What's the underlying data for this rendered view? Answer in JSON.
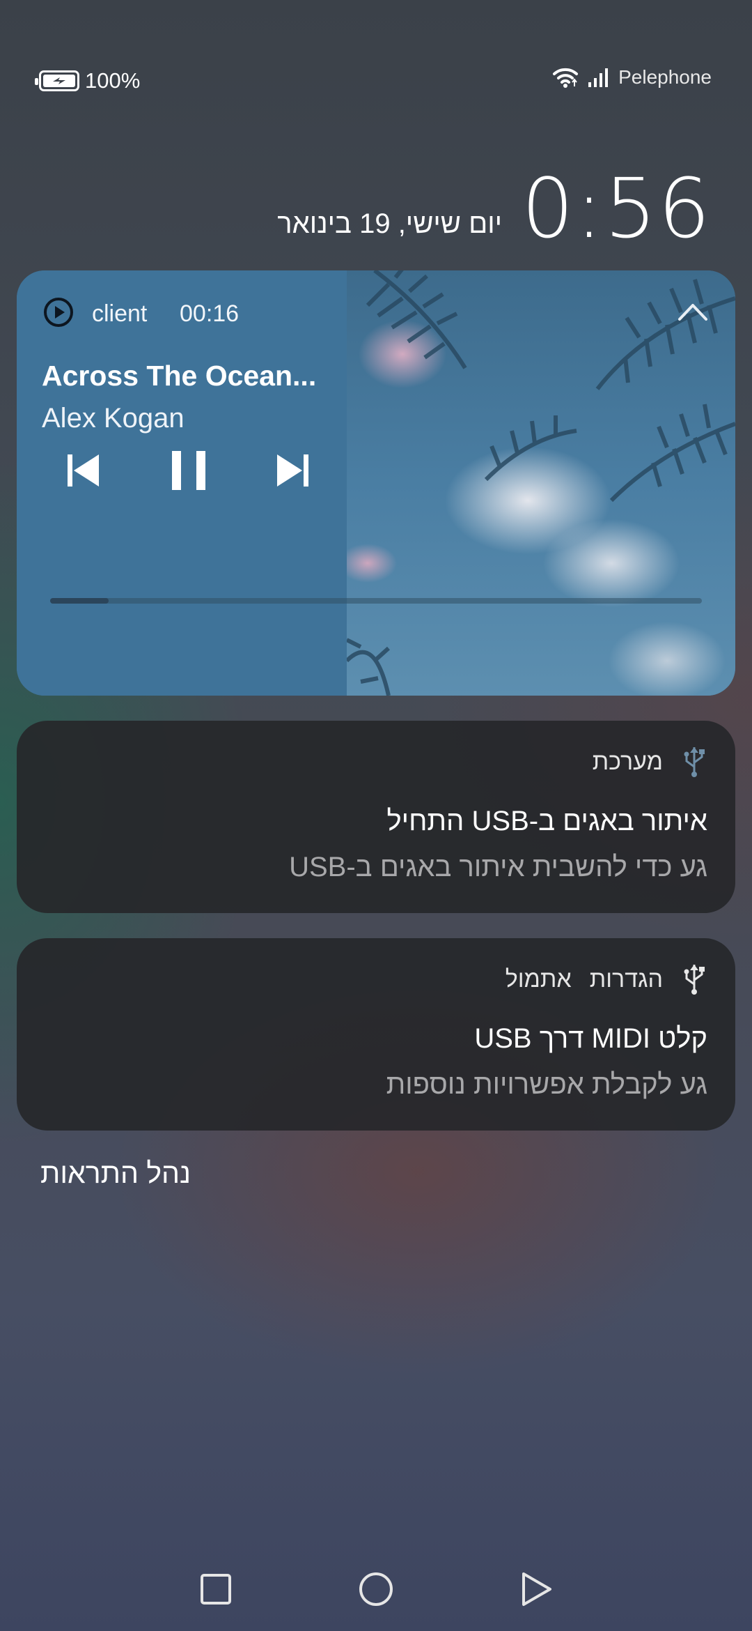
{
  "status_bar": {
    "battery_percent": "100%",
    "battery_level": 1.0,
    "carrier": "Pelephone",
    "icons": [
      "battery-charging-icon",
      "wifi-icon",
      "cell-signal-icon"
    ]
  },
  "lockscreen": {
    "time": "0:56",
    "date": "יום שישי, 19 בינואר"
  },
  "media": {
    "app_name": "client",
    "elapsed": "00:16",
    "title": "Across The Ocean...",
    "artist": "Alex Kogan",
    "progress": 0.09,
    "accent": "#3f7399",
    "icons": [
      "play-circle-icon",
      "chevron-up-icon",
      "skip-previous-icon",
      "pause-icon",
      "skip-next-icon"
    ]
  },
  "notifications": [
    {
      "app": "מערכת",
      "title": "איתור באגים ב-USB התחיל",
      "body": "גע כדי להשבית איתור באגים ב-USB",
      "icon": "usb-icon"
    },
    {
      "app": "הגדרות",
      "time": "אתמול",
      "title": "קלט MIDI דרך USB",
      "body": "גע לקבלת אפשרויות נוספות",
      "icon": "usb-icon"
    }
  ],
  "manage_label": "נהל התראות",
  "nav": {
    "icons": [
      "recents-square-icon",
      "home-circle-icon",
      "back-triangle-icon"
    ]
  }
}
